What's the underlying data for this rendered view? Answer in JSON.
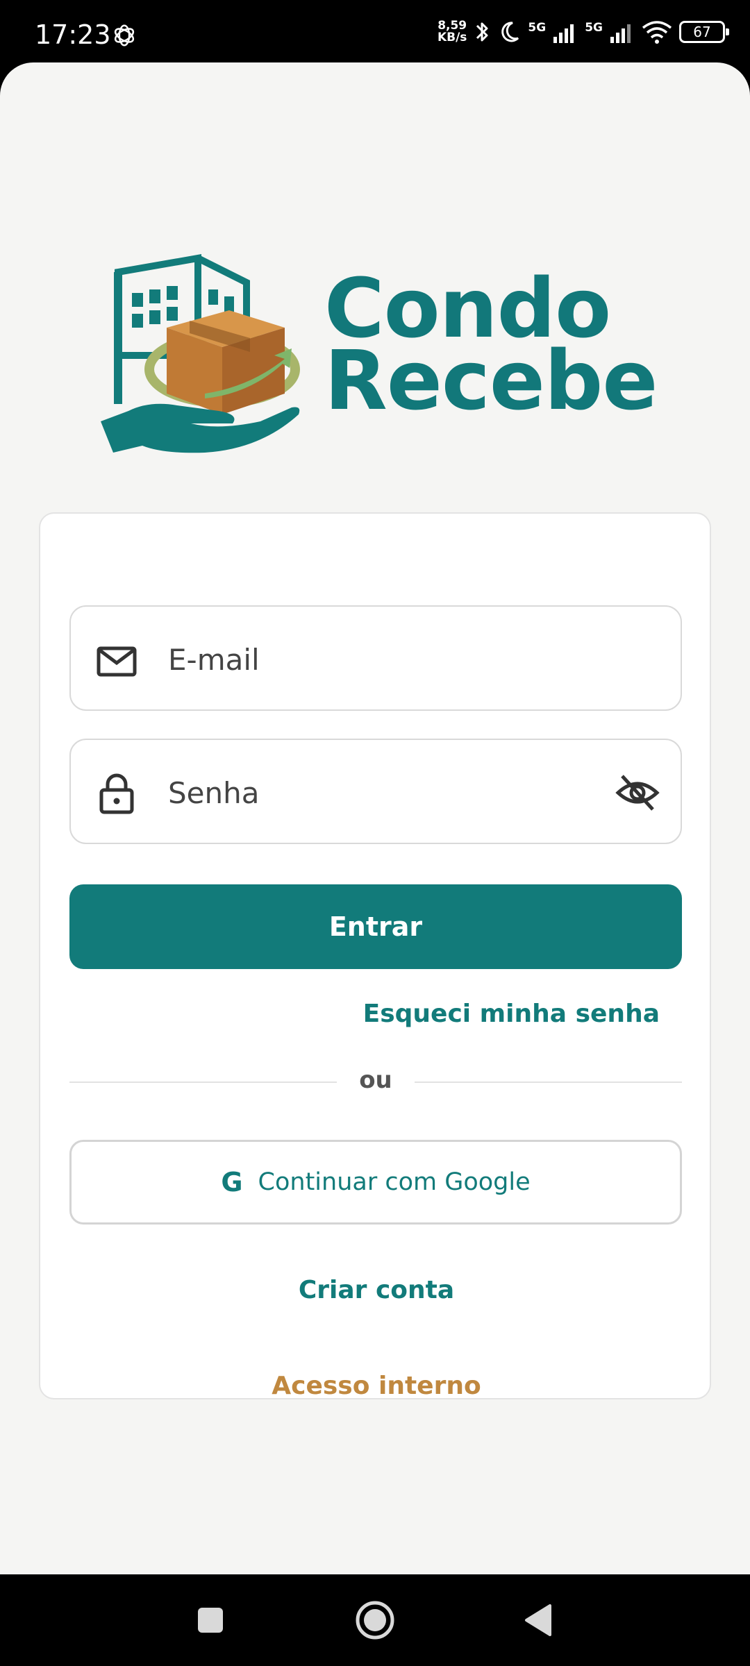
{
  "status_bar": {
    "time": "17:23",
    "net_speed_value": "8,59",
    "net_speed_unit": "KB/s",
    "signal1_label": "5G",
    "signal2_label": "5G",
    "battery": "67"
  },
  "logo": {
    "line1": "Condo",
    "line2": "Recebe"
  },
  "login_form": {
    "email_placeholder": "E-mail",
    "password_placeholder": "Senha",
    "submit_label": "Entrar",
    "forgot_password": "Esqueci minha senha",
    "divider_text": "ou",
    "google_icon_letter": "G",
    "google_label": "Continuar com Google",
    "create_account": "Criar conta",
    "internal_access": "Acesso interno"
  },
  "colors": {
    "brand_teal": "#127b7a",
    "accent_orange": "#c0883f"
  },
  "icons": {
    "email": "mail-icon",
    "password": "lock-icon",
    "toggle": "eye-off-icon"
  }
}
